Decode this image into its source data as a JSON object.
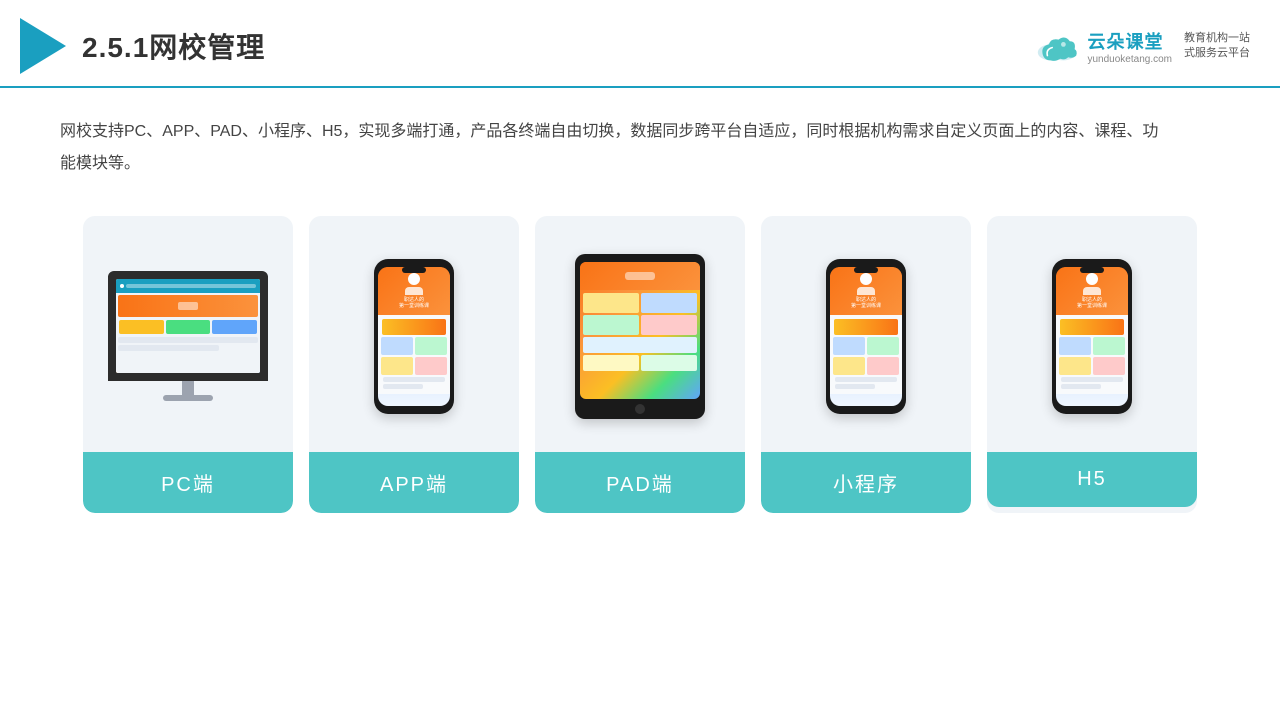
{
  "header": {
    "title": "2.5.1网校管理",
    "brand": {
      "name": "云朵课堂",
      "url": "yunduoketang.com",
      "slogan": "教育机构一站\n式服务云平台"
    }
  },
  "description": "网校支持PC、APP、PAD、小程序、H5，实现多端打通，产品各终端自由切换，数据同步跨平台自适应，同时根据机构需求自定义页面上的内容、课程、功能模块等。",
  "cards": [
    {
      "id": "pc",
      "label": "PC端"
    },
    {
      "id": "app",
      "label": "APP端"
    },
    {
      "id": "pad",
      "label": "PAD端"
    },
    {
      "id": "miniapp",
      "label": "小程序"
    },
    {
      "id": "h5",
      "label": "H5"
    }
  ]
}
